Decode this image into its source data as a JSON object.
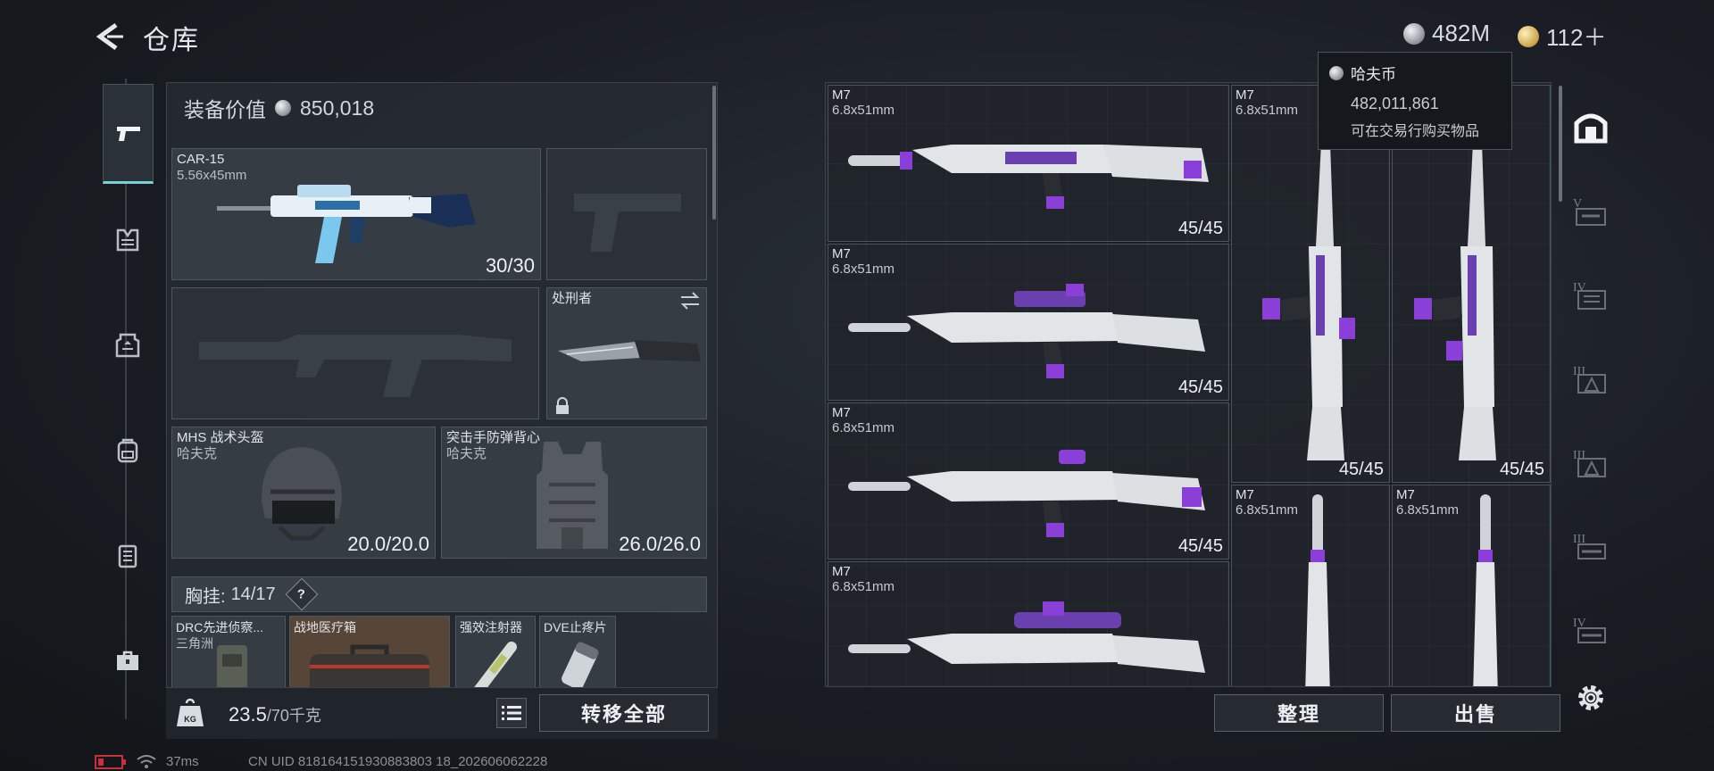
{
  "header": {
    "title": "仓库",
    "silver_amount": "482M",
    "gold_amount": "112＋"
  },
  "tooltip": {
    "title": "哈夫币",
    "amount": "482,011,861",
    "description": "可在交易行购买物品"
  },
  "loadout": {
    "value_label": "装备价值",
    "value": "850,018",
    "primary": {
      "name": "CAR-15",
      "caliber": "5.56x45mm",
      "ammo": "30/30"
    },
    "melee": {
      "name": "处刑者"
    },
    "helmet": {
      "name": "MHS 战术头盔",
      "brand": "哈夫克",
      "durability": "20.0/20.0"
    },
    "armor": {
      "name": "突击手防弹背心",
      "brand": "哈夫克",
      "durability": "26.0/26.0"
    },
    "chest_rig": {
      "label": "胸挂:",
      "used": "14",
      "capacity": "/17",
      "help": "?"
    },
    "rig_items": [
      {
        "name": "DRC先进侦察...",
        "sub": "三角洲"
      },
      {
        "name": "战地医疗箱",
        "sub": ""
      },
      {
        "name": "强效注射器",
        "sub": ""
      },
      {
        "name": "DVE止疼片",
        "sub": ""
      }
    ],
    "weight": "23.5",
    "weight_capacity": "/70千克",
    "transfer_all": "转移全部"
  },
  "storage": {
    "items": [
      {
        "name": "M7",
        "caliber": "6.8x51mm",
        "ammo": "45/45"
      },
      {
        "name": "M7",
        "caliber": "6.8x51mm",
        "ammo": "45/45"
      },
      {
        "name": "M7",
        "caliber": "6.8x51mm",
        "ammo": "45/45"
      },
      {
        "name": "M7",
        "caliber": "6.8x51mm",
        "ammo": ""
      },
      {
        "name": "M7",
        "caliber": "6.8x51mm",
        "ammo": "45/45"
      },
      {
        "name": "M7",
        "caliber": "6.8x51mm",
        "ammo": "45/45"
      },
      {
        "name": "M7",
        "caliber": "6.8x51mm",
        "ammo": ""
      },
      {
        "name": "M7",
        "caliber": "6.8x51mm",
        "ammo": ""
      }
    ],
    "sort_label": "整理",
    "sell_label": "出售"
  },
  "status": {
    "ping": "37ms",
    "uid": "CN UID 818164151930883803 18_202606062228"
  },
  "icons": {
    "nav": [
      "pistol-icon",
      "backpack-rig-icon",
      "helmet-armor-icon",
      "backpack-icon",
      "case-icon",
      "toolbox-icon"
    ],
    "rail": [
      "storage-icon",
      "tier-v-icon",
      "tier-iv-icon",
      "tier-iii-icon",
      "tier-ii-icon",
      "tier-iii-icon",
      "tier-iv-icon"
    ]
  },
  "colors": {
    "accent_cyan": "#7ad0d4",
    "weapon_purple": "#8b3fd9",
    "silver_coin": "#c0c4c8",
    "gold_coin": "#c9a248"
  }
}
